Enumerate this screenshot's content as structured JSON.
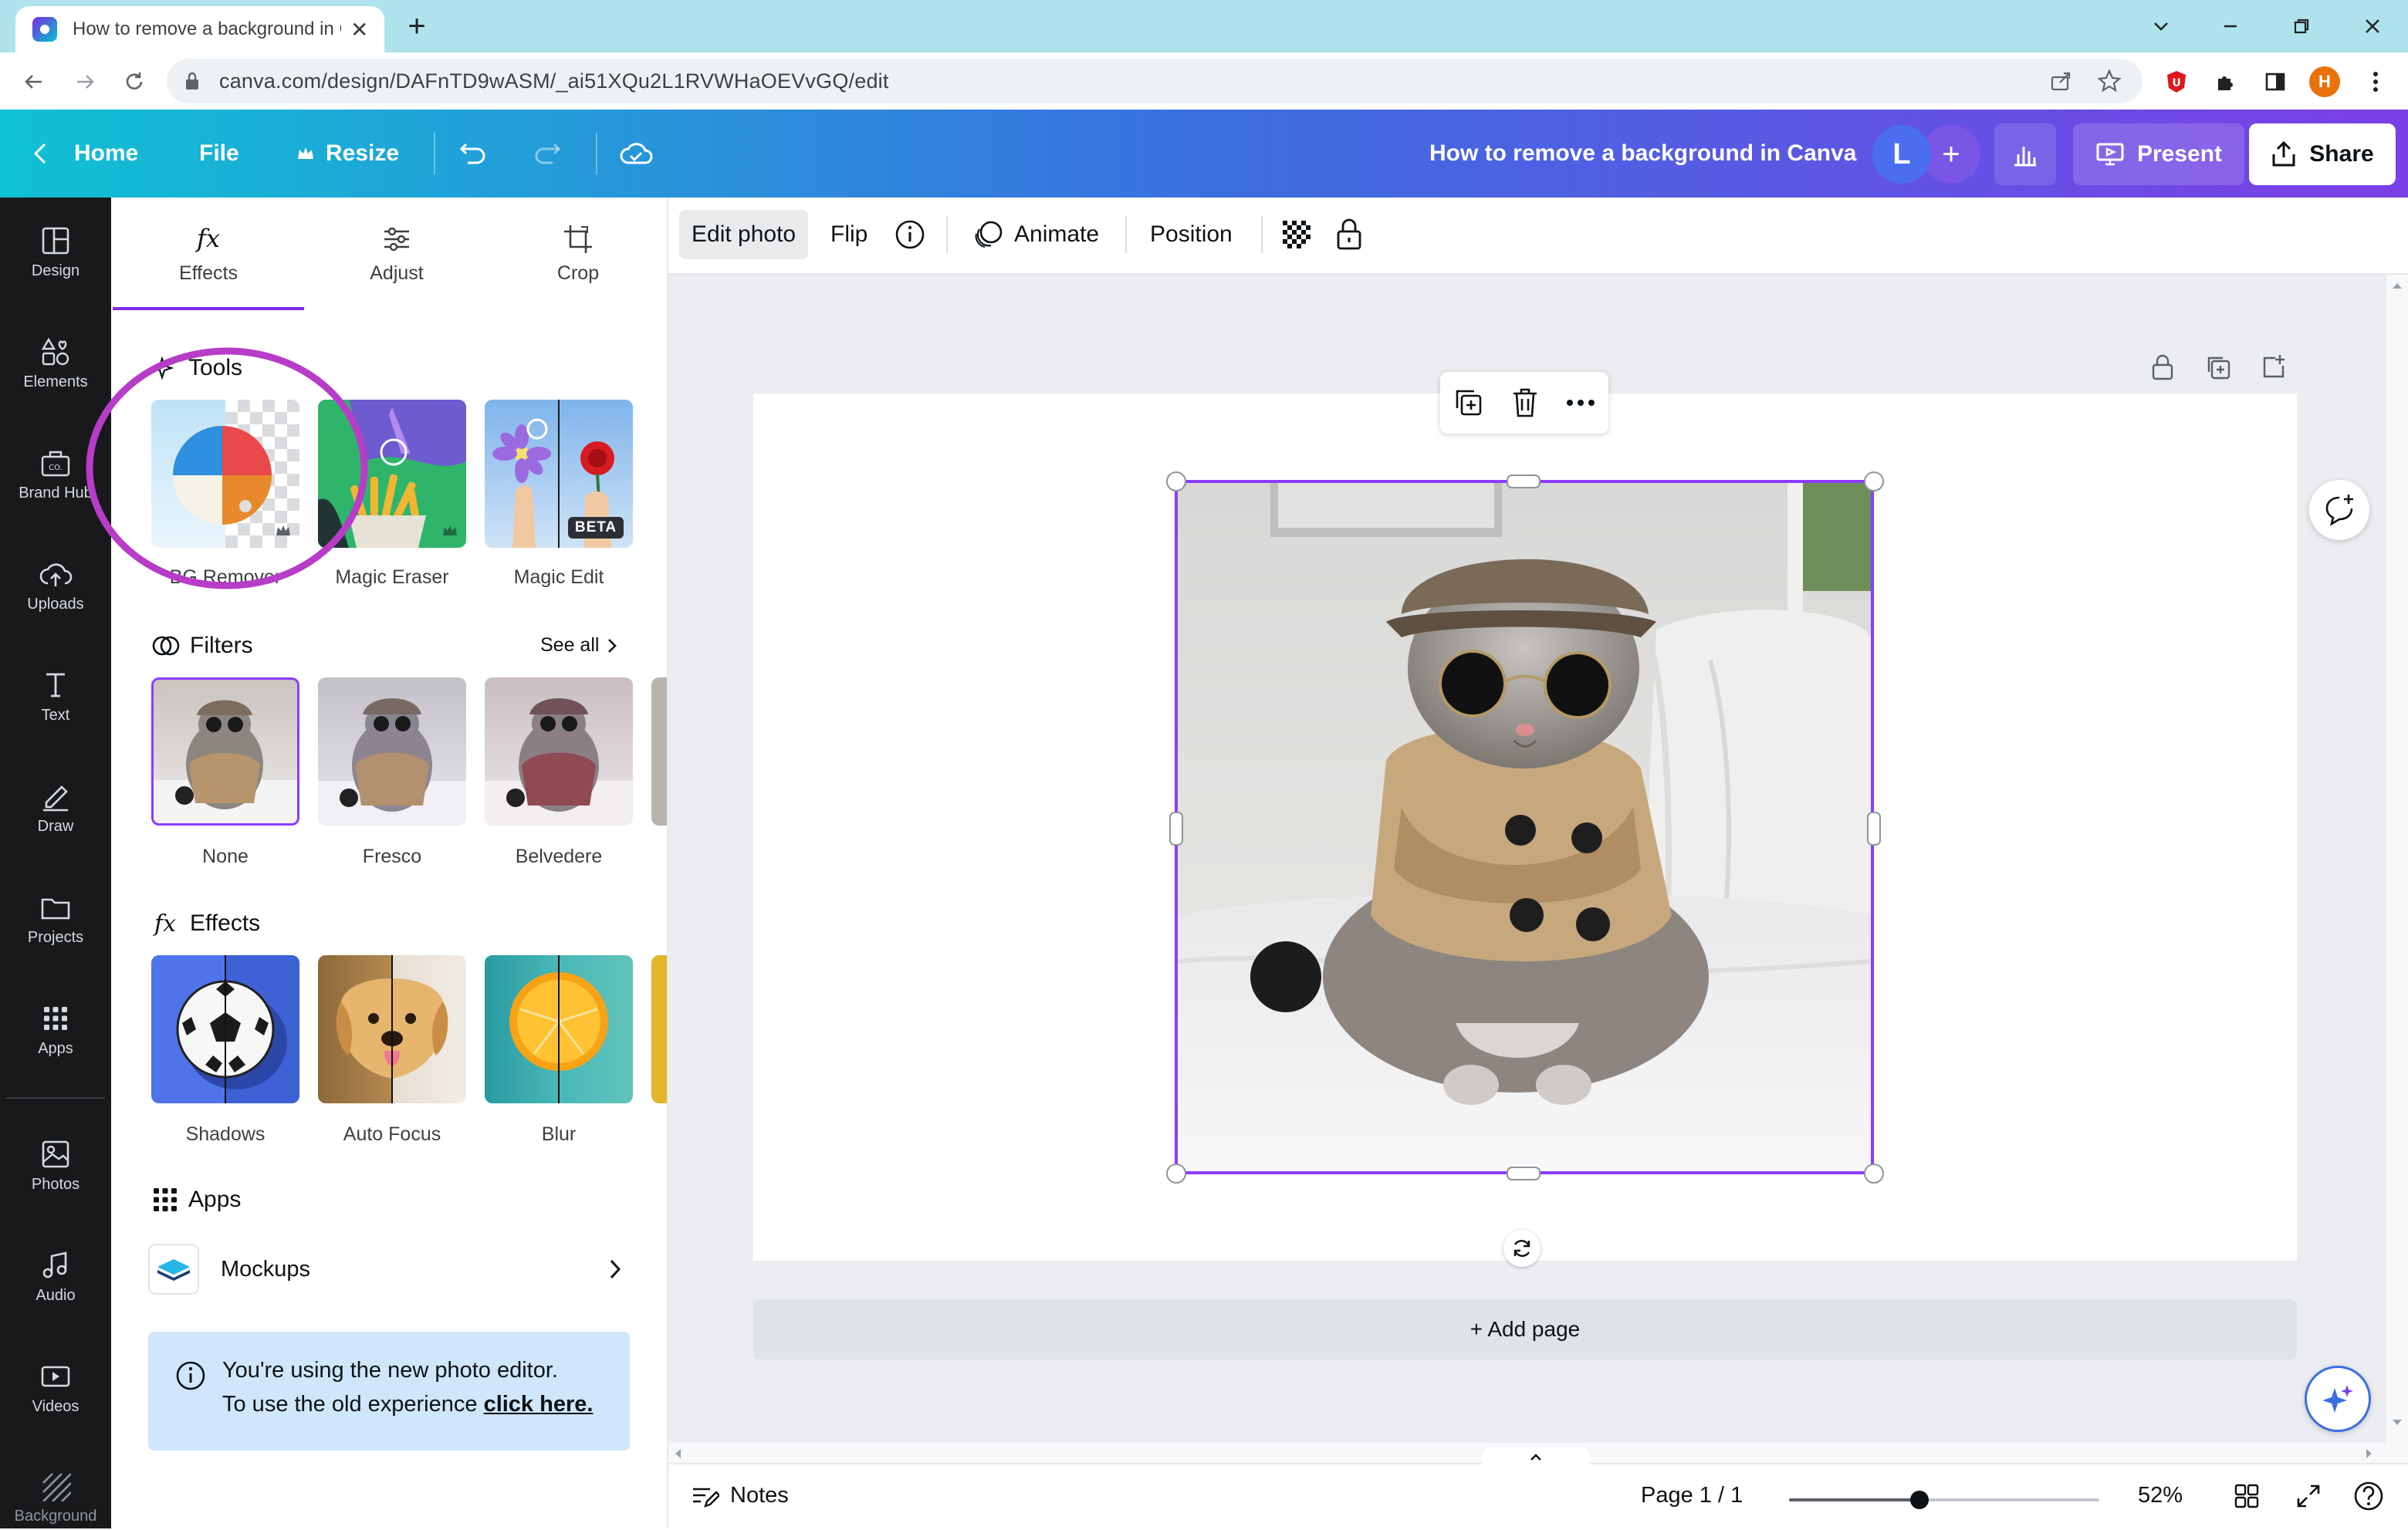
{
  "browser": {
    "tab_title": "How to remove a background in Canva",
    "url": "canva.com/design/DAFnTD9wASM/_ai51XQu2L1RVWHaOEVvGQ/edit",
    "profile_initial": "H"
  },
  "header": {
    "home": "Home",
    "file": "File",
    "resize": "Resize",
    "doc_title": "How to remove a background in Canva",
    "collab_initial": "L",
    "add": "+",
    "present": "Present",
    "share": "Share"
  },
  "rail": {
    "items": [
      {
        "label": "Design",
        "icon": "layout-icon"
      },
      {
        "label": "Elements",
        "icon": "shapes-icon"
      },
      {
        "label": "Brand Hub",
        "icon": "brand-icon"
      },
      {
        "label": "Uploads",
        "icon": "cloud-upload-icon"
      },
      {
        "label": "Text",
        "icon": "text-icon"
      },
      {
        "label": "Draw",
        "icon": "pen-icon"
      },
      {
        "label": "Projects",
        "icon": "folder-icon"
      },
      {
        "label": "Apps",
        "icon": "grid-icon"
      },
      {
        "label": "Photos",
        "icon": "image-icon"
      },
      {
        "label": "Audio",
        "icon": "music-icon"
      },
      {
        "label": "Videos",
        "icon": "video-icon"
      },
      {
        "label": "Background",
        "icon": "pattern-icon"
      }
    ]
  },
  "panel": {
    "tabs": [
      {
        "label": "Effects"
      },
      {
        "label": "Adjust"
      },
      {
        "label": "Crop"
      }
    ],
    "tools": {
      "heading": "Tools",
      "items": [
        {
          "label": "BG Remover"
        },
        {
          "label": "Magic Eraser"
        },
        {
          "label": "Magic Edit",
          "badge": "BETA"
        }
      ]
    },
    "filters": {
      "heading": "Filters",
      "see_all": "See all",
      "items": [
        {
          "label": "None"
        },
        {
          "label": "Fresco"
        },
        {
          "label": "Belvedere"
        }
      ]
    },
    "effects": {
      "heading": "Effects",
      "items": [
        {
          "label": "Shadows"
        },
        {
          "label": "Auto Focus"
        },
        {
          "label": "Blur"
        }
      ]
    },
    "apps": {
      "heading": "Apps",
      "items": [
        {
          "label": "Mockups"
        }
      ]
    },
    "info": {
      "line1": "You're using the new photo editor.",
      "line2_prefix": "To use the old experience ",
      "link": "click here."
    }
  },
  "toolbar": {
    "edit_photo": "Edit photo",
    "flip": "Flip",
    "animate": "Animate",
    "position": "Position"
  },
  "canvas": {
    "add_page": "+ Add page"
  },
  "footer": {
    "notes": "Notes",
    "page": "Page 1 / 1",
    "zoom": "52%",
    "zoom_level": 0.42
  },
  "colors": {
    "accent": "#8b3dff",
    "header_start": "#10c1d3",
    "header_end": "#7b3fe6",
    "rail_bg": "#18191b",
    "highlight_circle": "#b73cc8"
  }
}
